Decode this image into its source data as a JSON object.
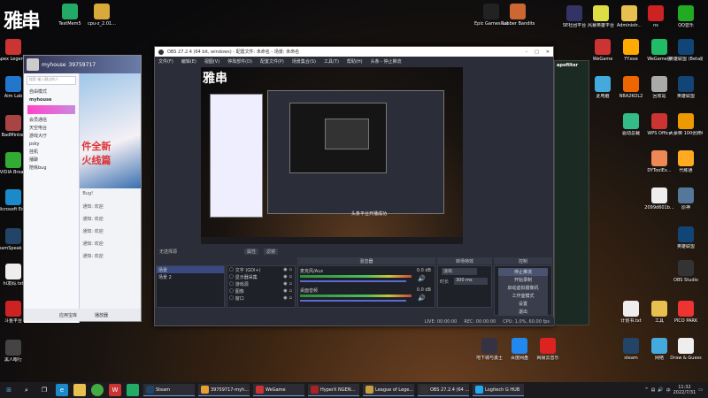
{
  "desktop_left": [
    {
      "label": "TestMem5",
      "color": "#2a6"
    },
    {
      "label": "cpu-z_2.01...",
      "color": "#d9a93a"
    },
    {
      "label": "Apex Legends",
      "color": "#c33"
    },
    {
      "label": "Aim Lab",
      "color": "#27c"
    },
    {
      "label": "BadMinton",
      "color": "#a44"
    },
    {
      "label": "NVIDIA Broadcast",
      "color": "#3a3"
    },
    {
      "label": "Microsoft Edge",
      "color": "#1a8acb"
    },
    {
      "label": "TeamSpeak 3 Client",
      "color": "#246"
    },
    {
      "label": "hi发码.txt",
      "color": "#eee"
    },
    {
      "label": "斗鱼平台",
      "color": "#c22"
    },
    {
      "label": "黑人眼行",
      "color": "#444"
    }
  ],
  "desktop_top": [
    {
      "label": "Epic Games Launcher",
      "color": "#222"
    },
    {
      "label": "Rubber Bandits",
      "color": "#c63"
    }
  ],
  "desktop_right": [
    {
      "label": "SE社团平台",
      "color": "#336"
    },
    {
      "label": "风暴英雄平台",
      "color": "#dd4"
    },
    {
      "label": "Administr...",
      "color": "#e8c050"
    },
    {
      "label": "ns",
      "color": "#c22"
    },
    {
      "label": "QQ音乐",
      "color": "#2a2"
    },
    {
      "label": "WeGame",
      "color": "#c33"
    },
    {
      "label": "YY.exe",
      "color": "#fa0"
    },
    {
      "label": "WeGame版",
      "color": "#2b6"
    },
    {
      "label": "英雄联盟 (Beta版)",
      "color": "#147"
    },
    {
      "label": "此电脑",
      "color": "#4ad"
    },
    {
      "label": "NBA2KOL2",
      "color": "#e60"
    },
    {
      "label": "回收站",
      "color": "#aaa"
    },
    {
      "label": "英雄联盟",
      "color": "#147"
    },
    {
      "label": "驱动总裁",
      "color": "#3b8"
    },
    {
      "label": "WPS Office",
      "color": "#c33"
    },
    {
      "label": "大豪棋 100张牌组",
      "color": "#e90"
    },
    {
      "label": "DYToolEx...",
      "color": "#e85"
    },
    {
      "label": "代练通",
      "color": "#fa2"
    },
    {
      "label": "2099d601b...",
      "color": "#eee"
    },
    {
      "label": "原神",
      "color": "#579"
    },
    {
      "label": "英雄联盟",
      "color": "#147"
    },
    {
      "label": "OBS Studio",
      "color": "#333"
    },
    {
      "label": "计划书.txt",
      "color": "#eee"
    },
    {
      "label": "工具",
      "color": "#e8c050"
    },
    {
      "label": "PICO PARK",
      "color": "#e33"
    },
    {
      "label": "steam",
      "color": "#246"
    },
    {
      "label": "网络",
      "color": "#4ad"
    },
    {
      "label": "Draw & Guess",
      "color": "#eee"
    }
  ],
  "desktop_bottom": [
    {
      "label": "地下城与勇士",
      "color": "#334"
    },
    {
      "label": "百度网盘",
      "color": "#28e"
    },
    {
      "label": "网易云音乐",
      "color": "#d22"
    }
  ],
  "logo_text": "雅串",
  "qq": {
    "username": "myhouse",
    "uid": "39759717",
    "search_placeholder": "搜索 输入聊过的人",
    "mode_label": "自由模式",
    "channel": "myhouse",
    "tree_items": [
      "会员通信",
      "天空电台",
      "游戏大厅",
      "psky",
      "挂机",
      "播聊",
      "陪练bug"
    ],
    "chat_lines": [
      "Bug!",
      "通知: 欢迎",
      "通知: 欢迎",
      "通知: 欢迎",
      "通知: 欢迎",
      "通知: 欢迎"
    ],
    "footer": [
      "应用宝库",
      "播放器"
    ]
  },
  "obs": {
    "title": "OBS 27.2.4 (64 bit, windows) - 配置文件: 未命名 - 场景: 未命名",
    "menu": [
      "文件(F)",
      "编辑(E)",
      "视图(V)",
      "停靠部件(D)",
      "配置文件(P)",
      "场景集合(S)",
      "工具(T)",
      "帮助(H)",
      "头条 - 停止推流"
    ],
    "docks": {
      "scenes": "场景",
      "sources": "来源",
      "mixer": "混音器",
      "transitions": "转场特效",
      "controls": "控制"
    },
    "scenes": [
      "场景",
      "场景 2"
    ],
    "no_source_label": "无选择源",
    "properties_label": "属性",
    "filters_label": "滤镜",
    "sources": [
      "文字 (GDI+)",
      "显示器采集",
      "游戏源",
      "图像",
      "窗口"
    ],
    "mixer": [
      {
        "name": "麦克风/Aux",
        "db": "0.0 dB"
      },
      {
        "name": "桌面音频",
        "db": "0.0 dB"
      }
    ],
    "transition": {
      "type": "淡出",
      "duration_label": "时长",
      "duration": "300 ms"
    },
    "controls": [
      "停止推流",
      "开始录制",
      "启动虚拟摄像机",
      "工作室模式",
      "设置",
      "退出"
    ],
    "preview_toast": "头条平台开播成功",
    "status": {
      "live": "LIVE: 00:00:00",
      "rec": "REC: 00:00:00",
      "cpu": "CPU: 1.0%, 60.00 fps"
    }
  },
  "taskbar": {
    "apps": [
      "Steam",
      "39759717-myh...",
      "WeGame",
      "HyperX NGEN...",
      "League of Lege...",
      "OBS 27.2.4 (64 ...",
      "Logitech G HUB"
    ],
    "app_colors": [
      "#246",
      "#e8a030",
      "#c33",
      "#a22",
      "#c8a040",
      "#333",
      "#2ae"
    ],
    "time": "11:32",
    "date": "2022/7/31"
  }
}
